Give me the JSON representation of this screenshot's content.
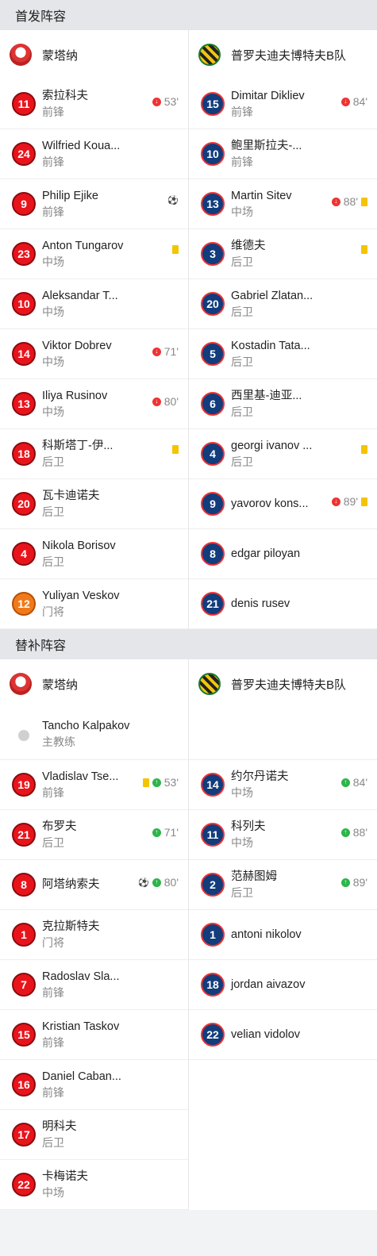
{
  "starting": {
    "title": "首发阵容",
    "home": {
      "team": "蒙塔纳",
      "players": [
        {
          "num": "11",
          "name": "索拉科夫",
          "pos": "前锋",
          "events": [
            {
              "type": "sub-out",
              "min": "53'"
            }
          ]
        },
        {
          "num": "24",
          "name": "Wilfried Koua...",
          "pos": "前锋",
          "events": []
        },
        {
          "num": "9",
          "name": "Philip Ejike",
          "pos": "前锋",
          "events": [
            {
              "type": "goal"
            }
          ]
        },
        {
          "num": "23",
          "name": "Anton Tungarov",
          "pos": "中场",
          "events": [
            {
              "type": "yellow"
            }
          ]
        },
        {
          "num": "10",
          "name": "Aleksandar T...",
          "pos": "中场",
          "events": []
        },
        {
          "num": "14",
          "name": "Viktor Dobrev",
          "pos": "中场",
          "events": [
            {
              "type": "sub-out",
              "min": "71'"
            }
          ]
        },
        {
          "num": "13",
          "name": "Iliya Rusinov",
          "pos": "中场",
          "events": [
            {
              "type": "sub-out",
              "min": "80'"
            }
          ]
        },
        {
          "num": "18",
          "name": "科斯塔丁-伊...",
          "pos": "后卫",
          "events": [
            {
              "type": "yellow"
            }
          ]
        },
        {
          "num": "20",
          "name": "瓦卡迪诺夫",
          "pos": "后卫",
          "events": []
        },
        {
          "num": "4",
          "name": "Nikola Borisov",
          "pos": "后卫",
          "events": []
        },
        {
          "num": "12",
          "name": "Yuliyan Veskov",
          "pos": "门将",
          "events": [],
          "gk": true
        }
      ]
    },
    "away": {
      "team": "普罗夫迪夫博特夫B队",
      "players": [
        {
          "num": "15",
          "name": "Dimitar Dikliev",
          "pos": "前锋",
          "events": [
            {
              "type": "sub-out",
              "min": "84'"
            }
          ]
        },
        {
          "num": "10",
          "name": "鲍里斯拉夫-...",
          "pos": "前锋",
          "events": []
        },
        {
          "num": "13",
          "name": "Martin Sitev",
          "pos": "中场",
          "events": [
            {
              "type": "sub-out",
              "min": "88'"
            },
            {
              "type": "yellow"
            }
          ]
        },
        {
          "num": "3",
          "name": "维德夫",
          "pos": "后卫",
          "events": [
            {
              "type": "yellow"
            }
          ]
        },
        {
          "num": "20",
          "name": "Gabriel Zlatan...",
          "pos": "后卫",
          "events": []
        },
        {
          "num": "5",
          "name": "Kostadin Tata...",
          "pos": "后卫",
          "events": []
        },
        {
          "num": "6",
          "name": "西里基-迪亚...",
          "pos": "后卫",
          "events": []
        },
        {
          "num": "4",
          "name": "georgi ivanov ...",
          "pos": "后卫",
          "events": [
            {
              "type": "yellow"
            }
          ]
        },
        {
          "num": "9",
          "name": "yavorov kons...",
          "pos": "",
          "events": [
            {
              "type": "sub-out",
              "min": "89'"
            },
            {
              "type": "yellow"
            }
          ]
        },
        {
          "num": "8",
          "name": "edgar piloyan",
          "pos": "",
          "events": []
        },
        {
          "num": "21",
          "name": "denis rusev",
          "pos": "",
          "events": []
        }
      ]
    }
  },
  "subs": {
    "title": "替补阵容",
    "home": {
      "team": "蒙塔纳",
      "coach": {
        "name": "Tancho Kalpakov",
        "role": "主教练"
      },
      "players": [
        {
          "num": "19",
          "name": "Vladislav Tse...",
          "pos": "前锋",
          "events": [
            {
              "type": "yellow"
            },
            {
              "type": "sub-in",
              "min": "53'"
            }
          ]
        },
        {
          "num": "21",
          "name": "布罗夫",
          "pos": "后卫",
          "events": [
            {
              "type": "sub-in",
              "min": "71'"
            }
          ]
        },
        {
          "num": "8",
          "name": "阿塔纳索夫",
          "pos": "",
          "events": [
            {
              "type": "goal"
            },
            {
              "type": "sub-in",
              "min": "80'"
            }
          ]
        },
        {
          "num": "1",
          "name": "克拉斯特夫",
          "pos": "门将",
          "events": []
        },
        {
          "num": "7",
          "name": "Radoslav Sla...",
          "pos": "前锋",
          "events": []
        },
        {
          "num": "15",
          "name": "Kristian Taskov",
          "pos": "前锋",
          "events": []
        },
        {
          "num": "16",
          "name": "Daniel Caban...",
          "pos": "前锋",
          "events": []
        },
        {
          "num": "17",
          "name": "明科夫",
          "pos": "后卫",
          "events": []
        },
        {
          "num": "22",
          "name": "卡梅诺夫",
          "pos": "中场",
          "events": []
        }
      ]
    },
    "away": {
      "team": "普罗夫迪夫博特夫B队",
      "players": [
        {
          "num": "14",
          "name": "约尔丹诺夫",
          "pos": "中场",
          "events": [
            {
              "type": "sub-in",
              "min": "84'"
            }
          ]
        },
        {
          "num": "11",
          "name": "科列夫",
          "pos": "中场",
          "events": [
            {
              "type": "sub-in",
              "min": "88'"
            }
          ]
        },
        {
          "num": "2",
          "name": "范赫图姆",
          "pos": "后卫",
          "events": [
            {
              "type": "sub-in",
              "min": "89'"
            }
          ]
        },
        {
          "num": "1",
          "name": "antoni nikolov",
          "pos": "",
          "events": []
        },
        {
          "num": "18",
          "name": "jordan aivazov",
          "pos": "",
          "events": []
        },
        {
          "num": "22",
          "name": "velian vidolov",
          "pos": "",
          "events": []
        }
      ]
    }
  },
  "colors": {
    "home_badge": "#e8141c",
    "away_badge": "#123c7c",
    "gk_badge": "#f07a1a",
    "yellow_card": "#f5c400",
    "sub_in": "#2cb54a",
    "sub_out": "#e33333"
  },
  "icons": {
    "sub_in": "sub-in-icon",
    "sub_out": "sub-out-icon",
    "goal": "goal-ball-icon",
    "yellow": "yellow-card-icon",
    "coach": "coach-avatar-icon"
  }
}
